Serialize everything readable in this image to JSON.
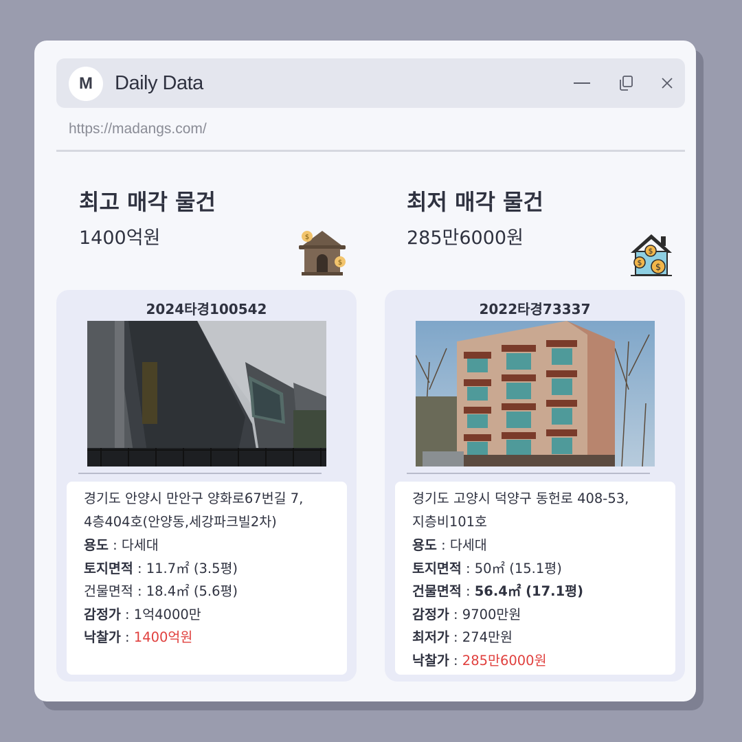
{
  "window": {
    "logo_letter": "M",
    "title": "Daily Data",
    "url": "https://madangs.com/"
  },
  "highest": {
    "heading": "최고 매각 물건",
    "amount": "1400억원",
    "icon": "house-money-icon",
    "card": {
      "case_number": "2024타경100542",
      "address_line1": "경기도 안양시 만안구 양화로67번길 7,",
      "address_line2": "4층404호(안양동,세강파크빌2차)",
      "rows": [
        {
          "label": "용도",
          "value": "다세대"
        },
        {
          "label": "토지면적",
          "value": "11.7㎡ (3.5평)"
        },
        {
          "label": "건물면적",
          "value": "18.4㎡ (5.6평)"
        },
        {
          "label": "감정가",
          "value": "1억4000만"
        },
        {
          "label": "낙찰가",
          "value": "1400억원"
        }
      ]
    }
  },
  "lowest": {
    "heading": "최저 매각 물건",
    "amount": "285만6000원",
    "icon": "house-coins-icon",
    "card": {
      "case_number": "2022타경73337",
      "address_line1": "경기도 고양시 덕양구 동헌로 408-53,",
      "address_line2": "지층비101호",
      "rows": [
        {
          "label": "용도",
          "value": "다세대"
        },
        {
          "label": "토지면적",
          "value": "50㎡ (15.1평)"
        },
        {
          "label": "건물면적",
          "value": "56.4㎡ (17.1평)"
        },
        {
          "label": "감정가",
          "value": "9700만원"
        },
        {
          "label": "최저가",
          "value": "274만원"
        },
        {
          "label": "낙찰가",
          "value": "285만6000원"
        }
      ]
    }
  },
  "colors": {
    "accent_red": "#e0403e",
    "background": "#9a9cae",
    "card": "#e9ebf7"
  }
}
